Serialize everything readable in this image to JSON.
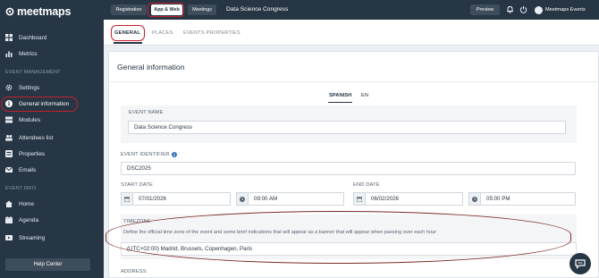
{
  "brand": {
    "name": "meetmaps",
    "logo_icon": "meetmaps-logo-icon"
  },
  "sidebar": {
    "items_top": [
      {
        "label": "Dashboard",
        "icon": "dashboard-icon"
      },
      {
        "label": "Metrics",
        "icon": "metrics-icon"
      }
    ],
    "section_event_management": "EVENT MANAGEMENT",
    "items_management": [
      {
        "label": "Settings",
        "icon": "gear-icon"
      },
      {
        "label": "General information",
        "icon": "info-icon"
      },
      {
        "label": "Modules",
        "icon": "modules-icon"
      },
      {
        "label": "Attendees list",
        "icon": "attendees-icon"
      },
      {
        "label": "Properties",
        "icon": "properties-icon"
      },
      {
        "label": "Emails",
        "icon": "email-icon"
      }
    ],
    "section_event_info": "EVENT INFO",
    "items_info": [
      {
        "label": "Home",
        "icon": "home-icon"
      },
      {
        "label": "Agenda",
        "icon": "calendar-icon"
      },
      {
        "label": "Streaming",
        "icon": "streaming-icon"
      }
    ],
    "help_center": "Help Center"
  },
  "topbar": {
    "buttons": [
      "Registration",
      "App & Web",
      "Meetings"
    ],
    "active_button": "App & Web",
    "event_title": "Data Science Congress",
    "preview": "Preview",
    "account_name": "Meetmaps Events"
  },
  "tabs": [
    "GENERAL",
    "PLACES",
    "EVENTS PROPERTIES"
  ],
  "active_tab": "GENERAL",
  "card": {
    "title": "General information",
    "languages": [
      "SPANISH",
      "EN"
    ],
    "selected_language": "SPANISH",
    "event_name": {
      "label": "EVENT NAME",
      "value": "Data Science Congress"
    },
    "event_identifier": {
      "label": "EVENT IDENTIFIER",
      "value": "DSC2025"
    },
    "start_date": {
      "label": "START DATE",
      "date": "07/01/2026",
      "time": "09:00 AM"
    },
    "end_date": {
      "label": "END DATE",
      "date": "06/02/2026",
      "time": "05:00 PM"
    },
    "timezone": {
      "label": "TIMEZONE",
      "hint": "Define the official time zone of the event and some brief indications that will appear as a banner that will appear when passing over each hour",
      "value": "(UTC+02:00) Madrid, Brussels, Copenhagen, Paris"
    },
    "address_label": "ADDRESS"
  },
  "colors": {
    "navy": "#263645",
    "annotation_red": "#c8202b",
    "annotation_brown": "#7a2a22"
  }
}
